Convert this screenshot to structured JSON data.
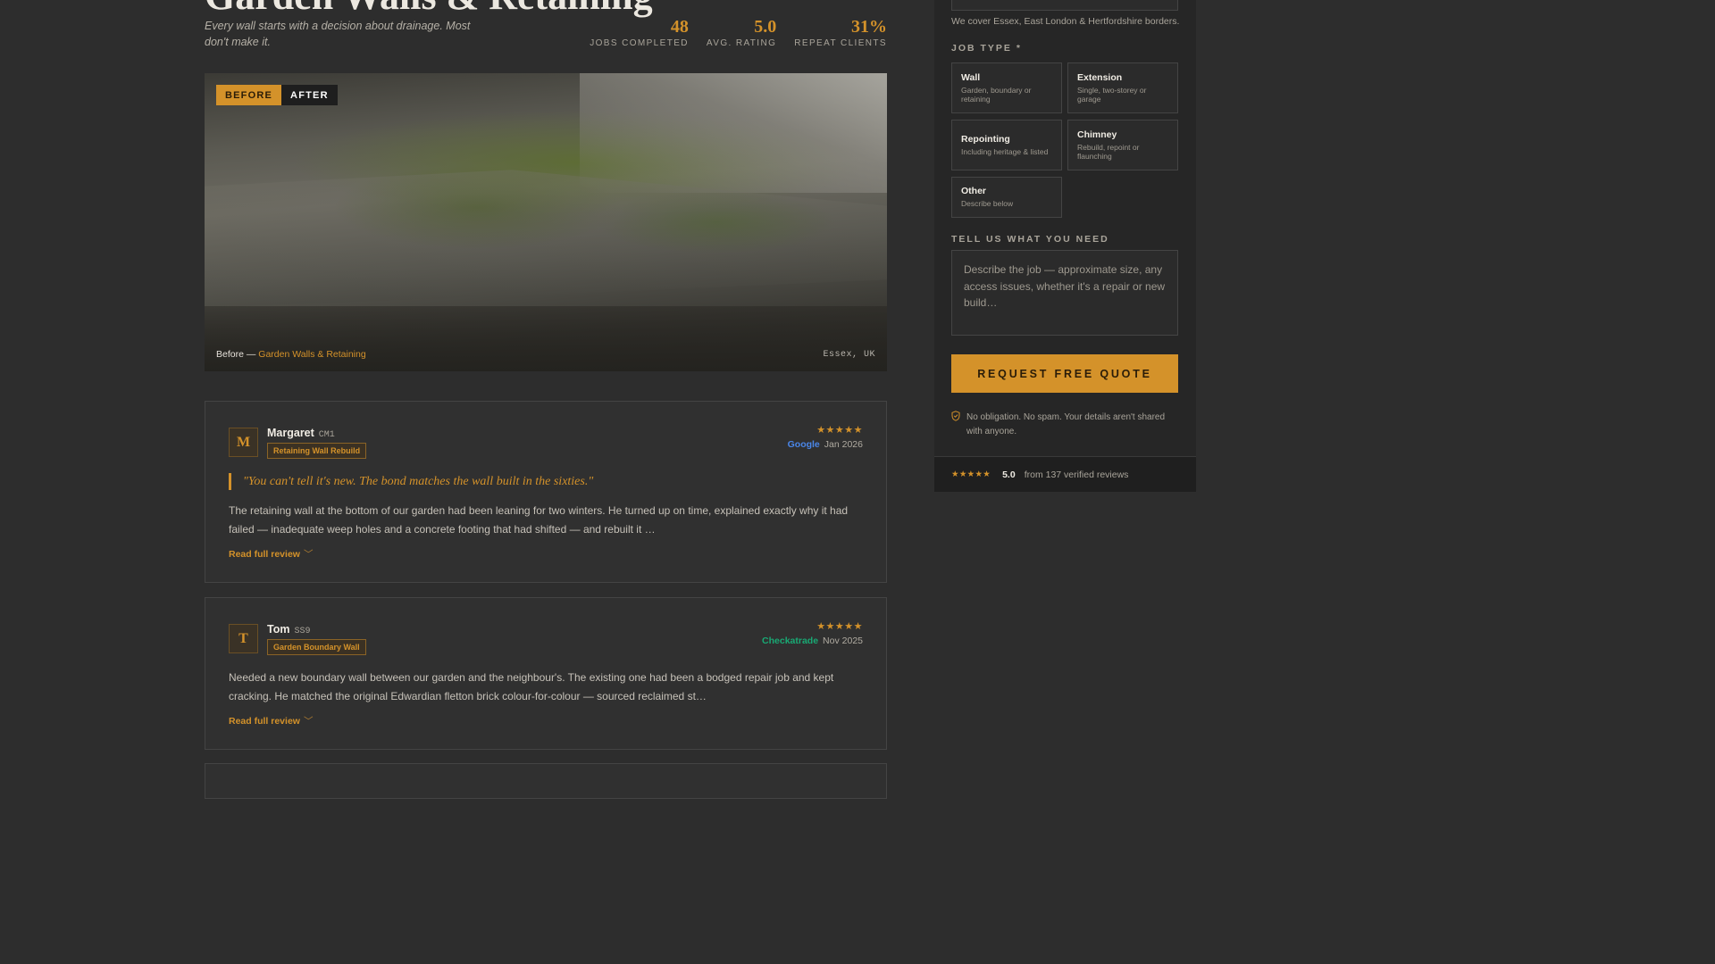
{
  "header": {
    "title": "Garden Walls & Retaining",
    "subtitle": "Every wall starts with a decision about drainage. Most don't make it."
  },
  "stats": [
    {
      "value": "48",
      "label": "JOBS COMPLETED"
    },
    {
      "value": "5.0",
      "label": "AVG. RATING"
    },
    {
      "value": "31%",
      "label": "REPEAT CLIENTS"
    }
  ],
  "gallery": {
    "before_label": "BEFORE",
    "after_label": "AFTER",
    "caption_prefix": "Before —",
    "caption_category": "Garden Walls & Retaining",
    "location": "Essex, UK"
  },
  "reviews": [
    {
      "initial": "M",
      "name": "Margaret",
      "postcode": "CM1",
      "job": "Retaining Wall Rebuild",
      "stars": "★★★★★",
      "source": "Google",
      "date": "Jan 2026",
      "quote": "\"You can't tell it's new. The bond matches the wall built in the sixties.\"",
      "body": "The retaining wall at the bottom of our garden had been leaning for two winters. He turned up on time, explained exactly why it had failed — inadequate weep holes and a concrete footing that had shifted — and rebuilt it …",
      "read_more": "Read full review"
    },
    {
      "initial": "T",
      "name": "Tom",
      "postcode": "SS9",
      "job": "Garden Boundary Wall",
      "stars": "★★★★★",
      "source": "Checkatrade",
      "date": "Nov 2025",
      "body": "Needed a new boundary wall between our garden and the neighbour's. The existing one had been a bodged repair job and kept cracking. He matched the original Edwardian fletton brick colour-for-colour — sourced reclaimed st…",
      "read_more": "Read full review"
    }
  ],
  "quote_form": {
    "coverage": "We cover Essex, East London & Hertfordshire borders.",
    "job_type_label": "JOB TYPE *",
    "job_types": [
      {
        "title": "Wall",
        "desc": "Garden, boundary or retaining"
      },
      {
        "title": "Extension",
        "desc": "Single, two-storey or garage"
      },
      {
        "title": "Repointing",
        "desc": "Including heritage & listed"
      },
      {
        "title": "Chimney",
        "desc": "Rebuild, repoint or flaunching"
      },
      {
        "title": "Other",
        "desc": "Describe below"
      }
    ],
    "needs_label": "TELL US WHAT YOU NEED",
    "needs_placeholder": "Describe the job — approximate size, any access issues, whether it's a repair or new build…",
    "submit_label": "REQUEST FREE QUOTE",
    "privacy": "No obligation. No spam. Your details aren't shared with anyone.",
    "footer_stars": "★★★★★",
    "footer_score": "5.0",
    "footer_count": "from 137 verified reviews"
  },
  "colors": {
    "accent": "#d4922a",
    "background": "#2d2d2d",
    "google": "#4a86e8",
    "checkatrade": "#19a974"
  },
  "icons": [
    "shield-check-icon",
    "chevron-down-icon",
    "star-icon"
  ]
}
